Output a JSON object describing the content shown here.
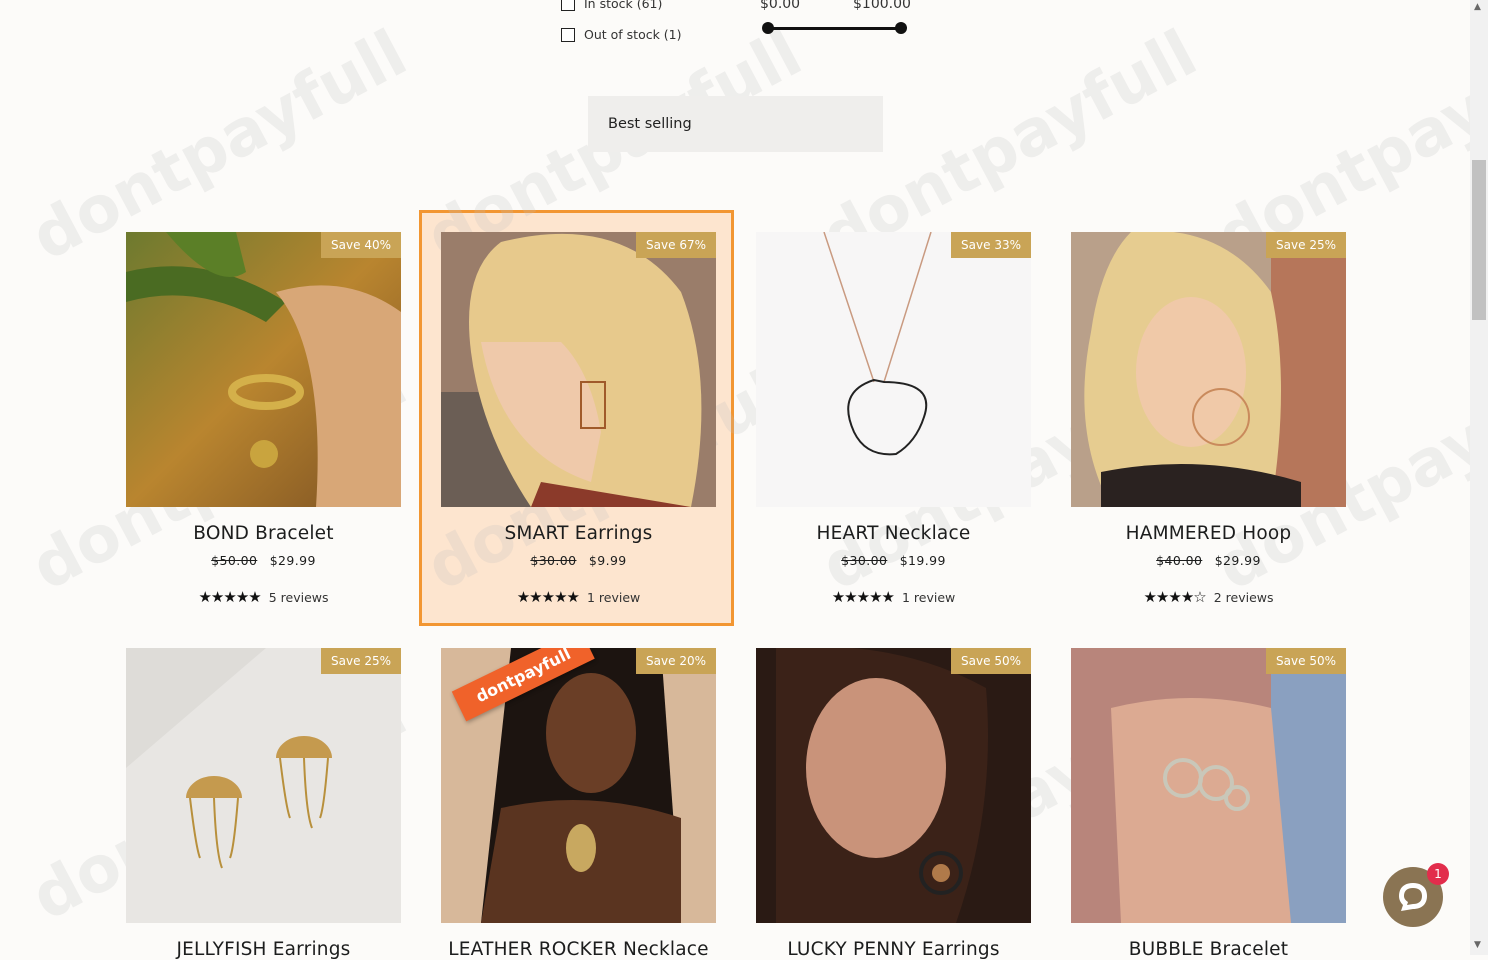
{
  "filters": {
    "availability": [
      {
        "label": "In stock (61)"
      },
      {
        "label": "Out of stock (1)"
      }
    ],
    "price": {
      "min_label": "$0.00",
      "max_label": "$100.00"
    }
  },
  "sort": {
    "selected": "Best selling"
  },
  "watermark": "dontpayfull",
  "products": [
    {
      "title": "BOND Bracelet",
      "badge": "Save 40%",
      "compare_price": "$50.00",
      "price": "$29.99",
      "stars": "★★★★★",
      "reviews": "5 reviews"
    },
    {
      "title": "SMART Earrings",
      "badge": "Save 67%",
      "compare_price": "$30.00",
      "price": "$9.99",
      "stars": "★★★★★",
      "reviews": "1 review"
    },
    {
      "title": "HEART Necklace",
      "badge": "Save 33%",
      "compare_price": "$30.00",
      "price": "$19.99",
      "stars": "★★★★★",
      "reviews": "1 review"
    },
    {
      "title": "HAMMERED Hoop",
      "badge": "Save 25%",
      "compare_price": "$40.00",
      "price": "$29.99",
      "stars": "★★★★☆",
      "reviews": "2 reviews"
    },
    {
      "title": "JELLYFISH Earrings",
      "badge": "Save 25%"
    },
    {
      "title": "LEATHER ROCKER Necklace",
      "badge": "Save 20%"
    },
    {
      "title": "LUCKY PENNY Earrings",
      "badge": "Save 50%"
    },
    {
      "title": "BUBBLE Bracelet",
      "badge": "Save 50%"
    }
  ],
  "chat": {
    "badge_count": "1"
  }
}
